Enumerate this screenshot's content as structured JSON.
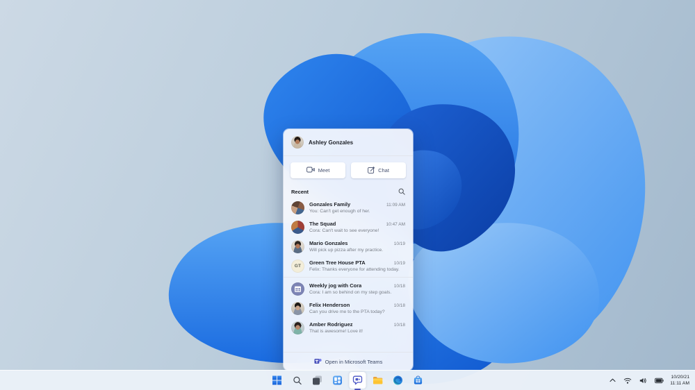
{
  "wallpaper": {
    "name": "windows-11-bloom"
  },
  "chat_flyout": {
    "header": {
      "user_name": "Ashley Gonzales"
    },
    "actions": {
      "meet_label": "Meet",
      "chat_label": "Chat"
    },
    "recent_label": "Recent",
    "conversations": [
      {
        "name": "Gonzales Family",
        "preview": "You: Can't get enough of her.",
        "time": "11:09 AM",
        "avatar": "group-photo-family"
      },
      {
        "name": "The Squad",
        "preview": "Cora: Can't wait to see everyone!",
        "time": "10:47 AM",
        "avatar": "group-photo-squad"
      },
      {
        "name": "Mario Gonzales",
        "preview": "Will pick up pizza after my practice.",
        "time": "10/19",
        "avatar": "photo-mario"
      },
      {
        "name": "Green Tree House PTA",
        "preview": "Felix: Thanks everyone for attending today.",
        "time": "10/19",
        "avatar": "initials",
        "initials": "GT",
        "divider_after": true
      },
      {
        "name": "Weekly jog with Cora",
        "preview": "Cora: I am so behind on my step goals.",
        "time": "10/18",
        "avatar": "calendar"
      },
      {
        "name": "Felix Henderson",
        "preview": "Can you drive me to the PTA today?",
        "time": "10/18",
        "avatar": "photo-felix"
      },
      {
        "name": "Amber Rodriguez",
        "preview": "That is awesome! Love it!",
        "time": "10/18",
        "avatar": "photo-amber"
      }
    ],
    "footer": {
      "open_label": "Open in Microsoft Teams"
    }
  },
  "taskbar": {
    "buttons": [
      {
        "id": "start",
        "icon": "windows-start-icon"
      },
      {
        "id": "search",
        "icon": "search-icon"
      },
      {
        "id": "task-view",
        "icon": "task-view-icon"
      },
      {
        "id": "widgets",
        "icon": "widgets-icon"
      },
      {
        "id": "chat",
        "icon": "teams-chat-icon",
        "active": true
      },
      {
        "id": "file-explorer",
        "icon": "folder-icon"
      },
      {
        "id": "edge",
        "icon": "edge-browser-icon"
      },
      {
        "id": "store",
        "icon": "microsoft-store-icon"
      }
    ]
  },
  "system_tray": {
    "icons": [
      "chevron-up-icon",
      "wifi-icon",
      "volume-icon",
      "battery-icon"
    ],
    "date": "10/20/21",
    "time": "11:11 AM"
  },
  "colors": {
    "accent": "#4b53bc",
    "taskbar_bg": "#eaf1f8",
    "panel_bg": "#f6f8fc"
  }
}
